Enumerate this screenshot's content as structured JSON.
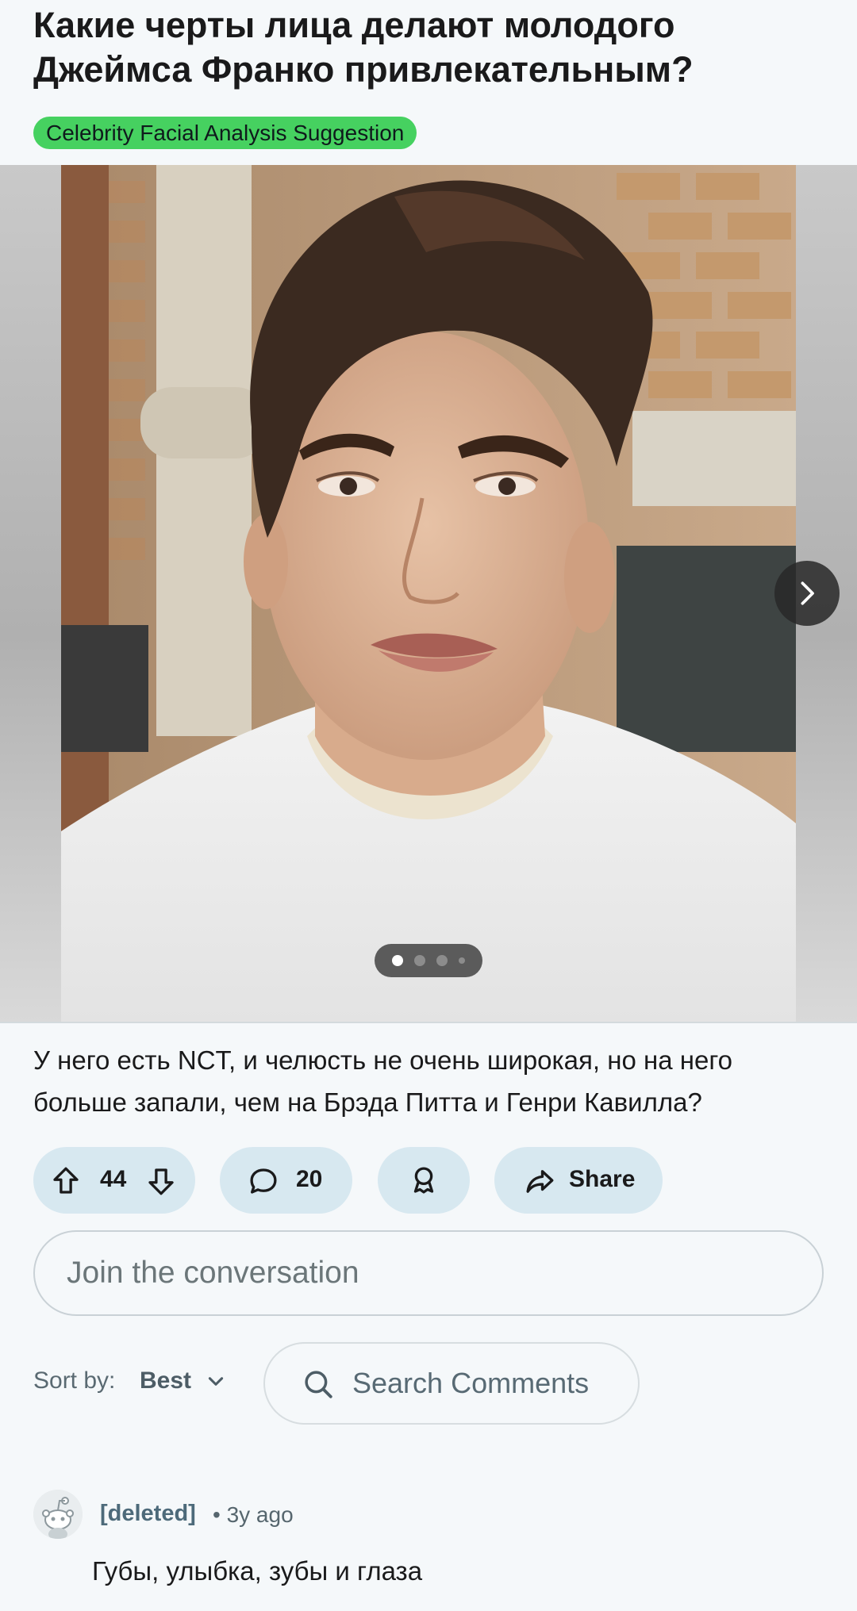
{
  "post": {
    "title": "Какие черты лица делают молодого Джеймса Франко привлекательным?",
    "flair": "Celebrity Facial Analysis Suggestion",
    "flair_color": "#46d160",
    "body": "У него есть NCT, и челюсть не очень широкая, но на него больше запали, чем на Брэда Питта и Генри Кавилла?",
    "gallery": {
      "total_images": 4,
      "current_index": 1,
      "next_icon": "chevron-right-icon"
    }
  },
  "actions": {
    "vote_count": "44",
    "comment_count": "20",
    "share_label": "Share",
    "pill_color": "#d7e8f0"
  },
  "composer": {
    "placeholder": "Join the conversation"
  },
  "sort": {
    "label": "Sort by:",
    "value": "Best"
  },
  "search": {
    "placeholder": "Search Comments"
  },
  "comments": [
    {
      "author": "[deleted]",
      "meta": "• 3y ago",
      "text": "Губы, улыбка, зубы и глаза"
    }
  ]
}
